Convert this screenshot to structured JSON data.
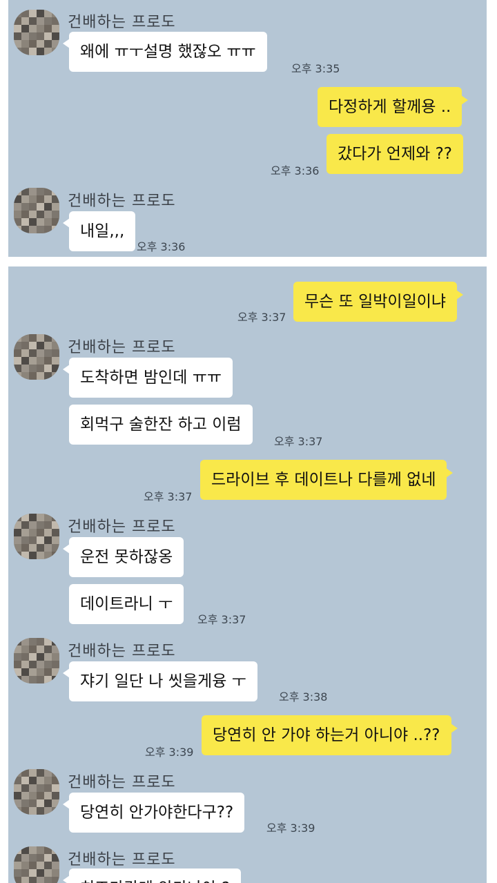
{
  "panel1": {
    "sender": "건배하는 프로도",
    "messages": {
      "in1": "왜에 ㅠㅜ설명 했잖오 ㅠㅠ",
      "time1": "오후 3:35",
      "out1": "다정하게 할께용 ..",
      "out2": "갔다가 언제와 ??",
      "time2": "오후 3:36",
      "in2": "내일,,,",
      "time3": "오후 3:36"
    }
  },
  "panel2": {
    "sender": "건배하는 프로도",
    "messages": {
      "out1": "무슨 또 일박이일이냐",
      "time1": "오후 3:37",
      "in1": "도착하면 밤인데 ㅠㅠ",
      "in2": "회먹구 술한잔 하고 이럼",
      "time2": "오후 3:37",
      "out2": "드라이브 후 데이트나 다를께 없네",
      "time3": "오후 3:37",
      "in3": "운전 못하잖옹",
      "in4": "데이트라니 ㅜ",
      "time4": "오후 3:37",
      "in5": "쟈기 일단 나 씻을게융 ㅜ",
      "time5": "오후 3:38",
      "out3": "당연히 안 가야 하는거 아니야 ..??",
      "time6": "오후 3:39",
      "in6": "당연히 안가야한다구??",
      "time7": "오후 3:39",
      "in7": "치즈가간데 안가나야 ?"
    }
  }
}
